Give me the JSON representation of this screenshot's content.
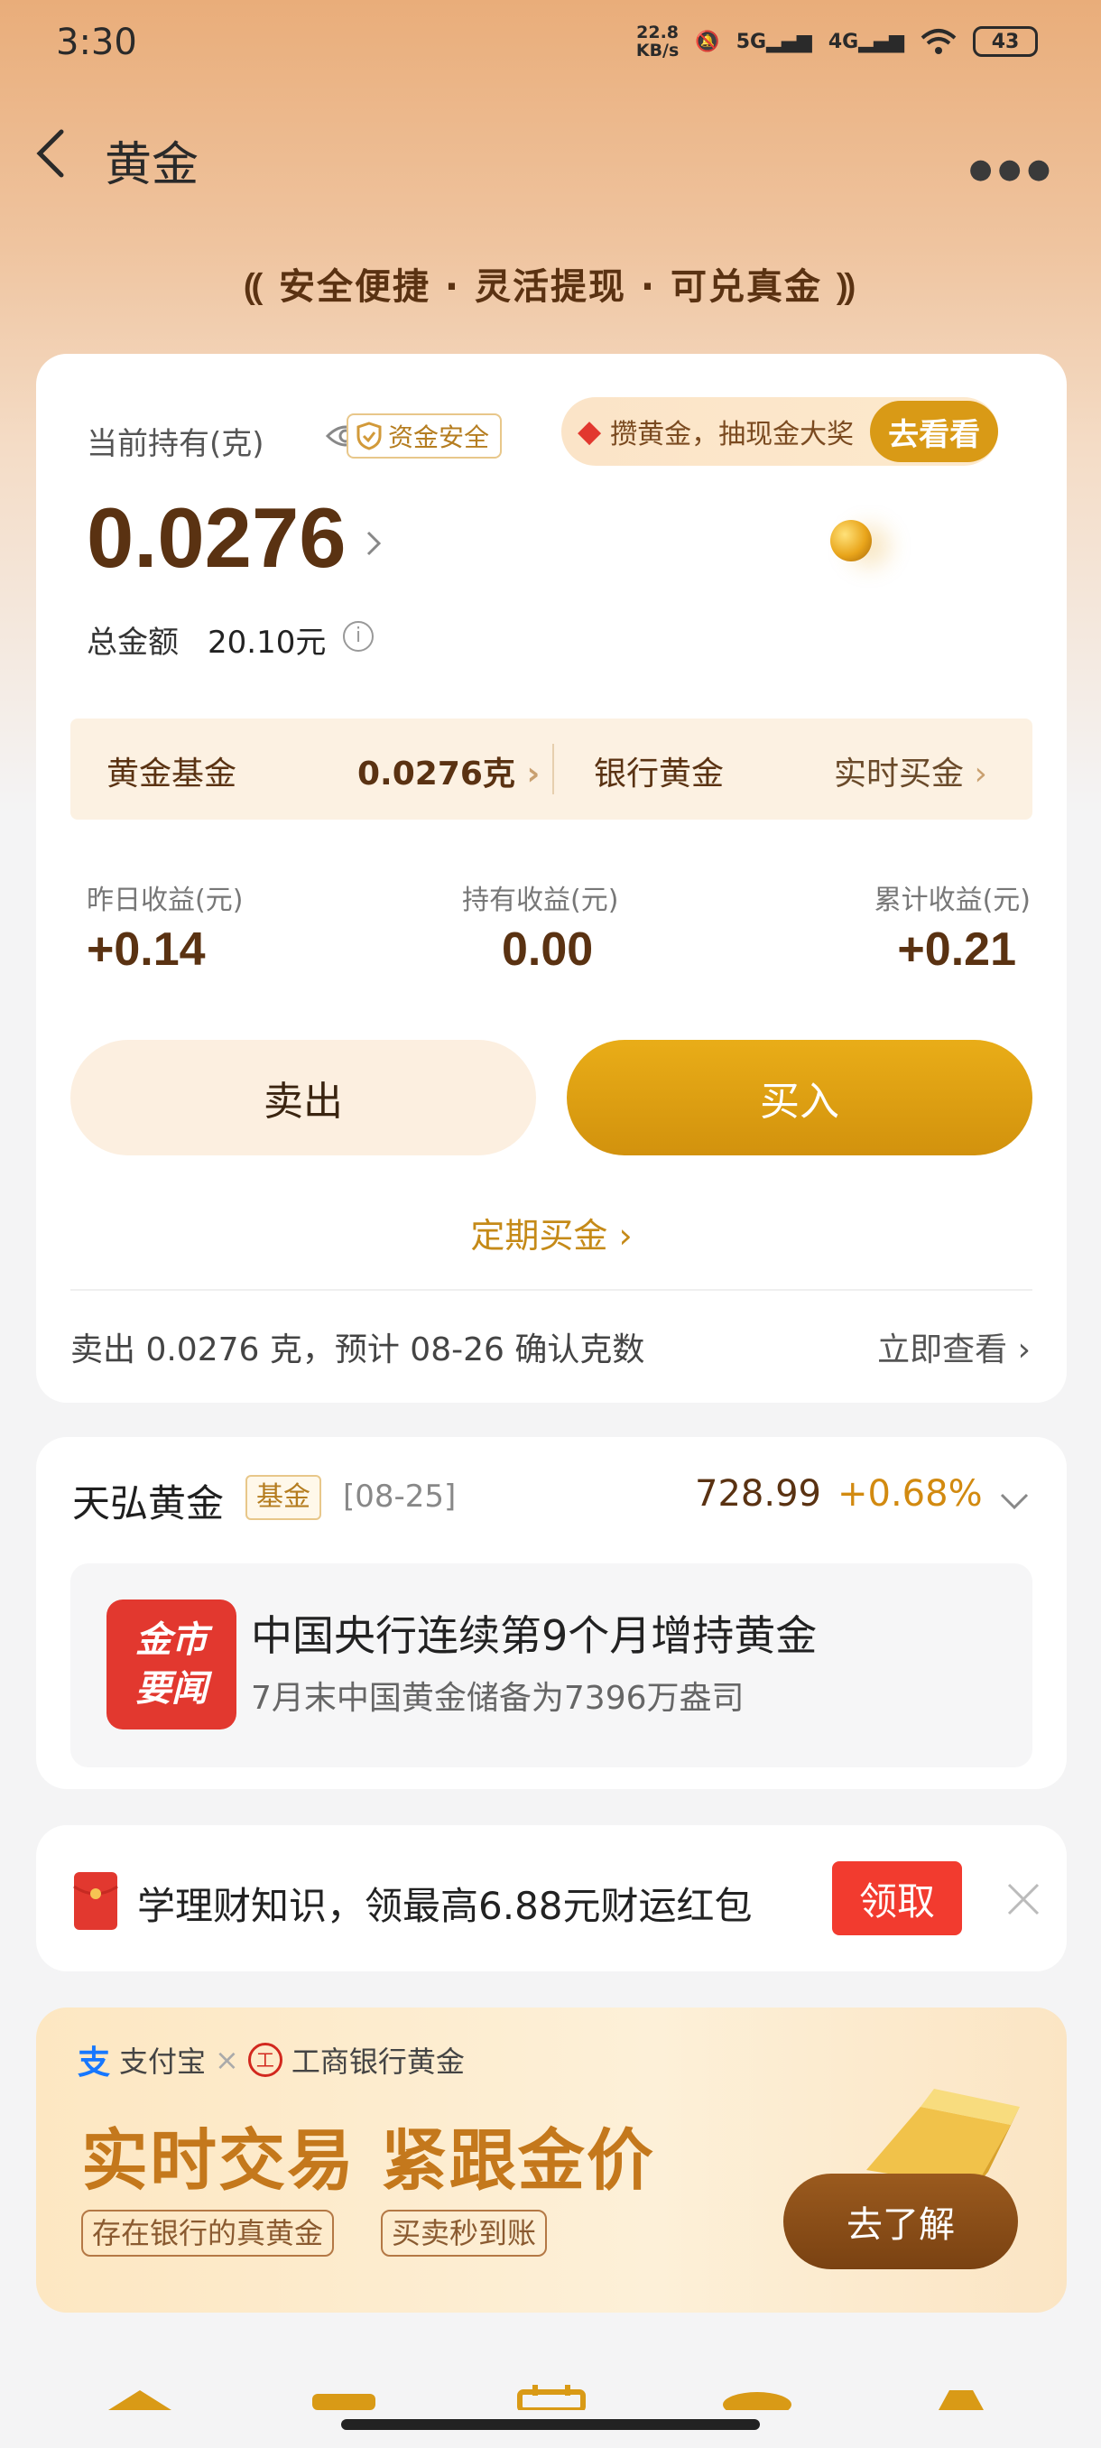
{
  "status_bar": {
    "time": "3:30",
    "net_speed_value": "22.8",
    "net_speed_unit": "KB/s",
    "signal_5g": "5G",
    "signal_4g": "4G",
    "battery": "43"
  },
  "header": {
    "title": "黄金"
  },
  "slogan": "安全便捷 · 灵活提现 · 可兑真金",
  "holding": {
    "label": "当前持有(克)",
    "safe_badge": "资金安全",
    "promo_text": "攒黄金，抽现金大奖",
    "promo_button": "去看看",
    "value": "0.0276",
    "total_label": "总金额",
    "total_value": "20.10元"
  },
  "split": {
    "fund_label": "黄金基金",
    "fund_value": "0.0276克",
    "bank_label": "银行黄金",
    "bank_action": "实时买金"
  },
  "stats": [
    {
      "label": "昨日收益(元)",
      "value": "+0.14"
    },
    {
      "label": "持有收益(元)",
      "value": "0.00"
    },
    {
      "label": "累计收益(元)",
      "value": "+0.21"
    }
  ],
  "actions": {
    "sell": "卖出",
    "buy": "买入",
    "regular": "定期买金"
  },
  "sell_notice": {
    "text": "卖出 0.0276 克，预计 08-26 确认克数",
    "link": "立即查看"
  },
  "fund": {
    "name": "天弘黄金",
    "tag": "基金",
    "date": "[08-25]",
    "price": "728.99",
    "change": "+0.68%",
    "news_badge_line1": "金市",
    "news_badge_line2": "要闻",
    "news_title": "中国央行连续第9个月增持黄金",
    "news_sub": "7月末中国黄金储备为7396万盎司"
  },
  "redpack": {
    "text": "学理财知识，领最高6.88元财运红包",
    "button": "领取"
  },
  "banner": {
    "brand1": "支付宝",
    "separator": "×",
    "brand2": "工商银行黄金",
    "title": "实时交易 紧跟金价",
    "tag1": "存在银行的真黄金",
    "tag2": "买卖秒到账",
    "button": "去了解"
  },
  "colors": {
    "accent_gold": "#d99a16",
    "brown_text": "#5a3212",
    "red": "#f23b2f"
  }
}
